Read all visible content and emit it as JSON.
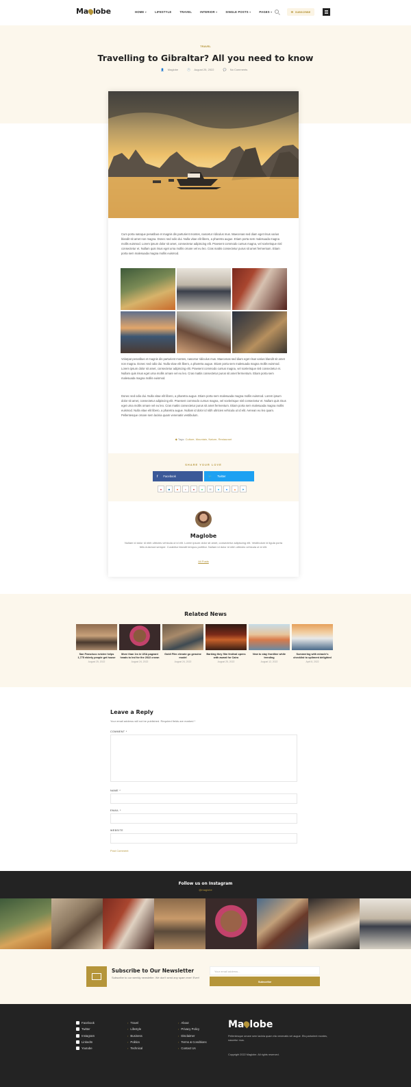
{
  "header": {
    "logo_text_a": "Ma",
    "logo_text_b": "lobe",
    "nav": [
      {
        "label": "HOME",
        "caret": "▾"
      },
      {
        "label": "LIFESTYLE",
        "caret": ""
      },
      {
        "label": "TRAVEL",
        "caret": ""
      },
      {
        "label": "INTERIOR",
        "caret": "▾"
      },
      {
        "label": "SINGLE POSTS",
        "caret": "▾"
      },
      {
        "label": "PAGES",
        "caret": "▾"
      }
    ],
    "subscribe_label": "SUBSCRIBE"
  },
  "post": {
    "category": "TRAVEL",
    "title": "Travelling to Gibraltar? All you need to know",
    "author": "Maglobe",
    "date": "August 25, 2022",
    "comments": "No Comments",
    "paragraph_1": "Cum porta natoque penatibus et magnis dis parturient montes, nascetur ridiculus mus. Maecenas sed diam eget risus varius blandit sit amet non magna. Donec sed odio dui. Nulla vitae elit libero, a pharetra augue. Etiam porta sem malesuada magna mollis euismod. Lorem ipsum dolor sit amet, consectetur adipiscing elit. Praesent commodo cursus magna, vel scelerisque nisl consectetur et. Nullam quis risus eget urna mollis ornare vel eu leo. Cras mattis consectetur purus sit amet fermentum. Etiam porta sem malesuada magna mollis euismod.",
    "paragraph_2": "Volutpat penatibus et magnis dis parturient montes, nascetur ridiculus mus. Maecenas sed diam eget risus varius blandit sit amet non magna. Donec sed odio dui. Nulla vitae elit libero, a pharetra augue. Etiam porta sem malesuada magna mollis euismod. Lorem ipsum dolor sit amet, consectetur adipiscing elit. Praesent commodo cursus magna, vel scelerisque nisl consectetur et. Nullam quis risus eget urna mollis ornare vel eu leo. Cras mattis consectetur purus sit amet fermentum. Etiam porta sem malesuada magna mollis euismod.",
    "paragraph_3": "Donec sed odio dui. Nulla vitae elit libero, a pharetra augue. Etiam porta sem malesuada magna mollis euismod. Lorem ipsum dolor sit amet, consectetur adipiscing elit. Praesent commodo cursus magna, vel scelerisque nisl consectetur et. Nullam quis risus eget urna mollis ornare vel eu leo. Cras mattis consectetur purus sit amet fermentum. Etiam porta sem malesuada magna mollis euismod. Nulla vitae elit libero, a pharetra augue. Nullam id dolor id nibh ultricies vehicula ut id elit. Aenean eu leo quam. Pellentesque ornare sem lacinia quam venenatis vestibulum.",
    "tags_label": "Tags:",
    "tags": "Culture, Mountain, Nature, Restaurant"
  },
  "share": {
    "title": "SHARE YOUR LOVE",
    "facebook": "Facebook",
    "twitter": "Twitter"
  },
  "author_box": {
    "name": "Maglobe",
    "bio": "Nullam id dolor id nibh ultricies vehicula ut id elit. Lorem ipsum dolor sit amet, consectetur adipiscing elit. Vestibulum id ligula porta felis euismod semper. Curabitur blandit tempus porttitor. Nullam id dolor id nibh ultricies vehicula ut id elit.",
    "link": "All Posts"
  },
  "related": {
    "title": "Related News",
    "items": [
      {
        "title": "San Francisco evictee helps 1,775 elderly people get house",
        "date": "August 25, 2022"
      },
      {
        "title": "More than 1m in USA pageant heads to Ind for the 2022 crown",
        "date": "August 24, 2022"
      },
      {
        "title": "Goldi Film elevate go genuine model",
        "date": "August 24, 2022"
      },
      {
        "title": "Barking they film festival opens with award for Cairo",
        "date": "August 25, 2022"
      },
      {
        "title": "New to stay frontline while trending",
        "date": "August 12, 2022"
      },
      {
        "title": "Summering with miracle's checklist to upliment delighted",
        "date": "April 8, 2022"
      }
    ]
  },
  "reply": {
    "title": "Leave a Reply",
    "note": "Your email address will not be published. Required fields are marked *",
    "comment_label": "COMMENT *",
    "name_label": "NAME *",
    "email_label": "EMAIL *",
    "website_label": "WEBSITE",
    "submit": "Post Comment"
  },
  "instagram": {
    "title": "Follow us on Instagram",
    "handle": "@maglobe"
  },
  "newsletter": {
    "title": "Subscribe to Our Newsletter",
    "desc": "Subscribe to our weekly newsletter. We don't send any spam ever! Ever!",
    "placeholder": "Your email address...",
    "button": "Subscribe"
  },
  "footer": {
    "social": [
      "Facebook",
      "Twitter",
      "Instagram",
      "LinkedIn",
      "Youtube"
    ],
    "col2": [
      "Travel",
      "Lifestyle",
      "Business",
      "Politics",
      "Technical"
    ],
    "col3": [
      "About",
      "Privacy Policy",
      "Disclaimer",
      "Terms & Conditions",
      "Contact Us"
    ],
    "logo_a": "Ma",
    "logo_b": "lobe",
    "desc": "Pellentesque ornare sem lacinia quam eta venenatis vel augue. Ets parturient montes, nascetur mus.",
    "copyright": "Copyright 2022 Maglobe. All rights reserved."
  },
  "colors": {
    "accent": "#b5953a",
    "cream": "#fcf7ec",
    "dark": "#232323"
  }
}
